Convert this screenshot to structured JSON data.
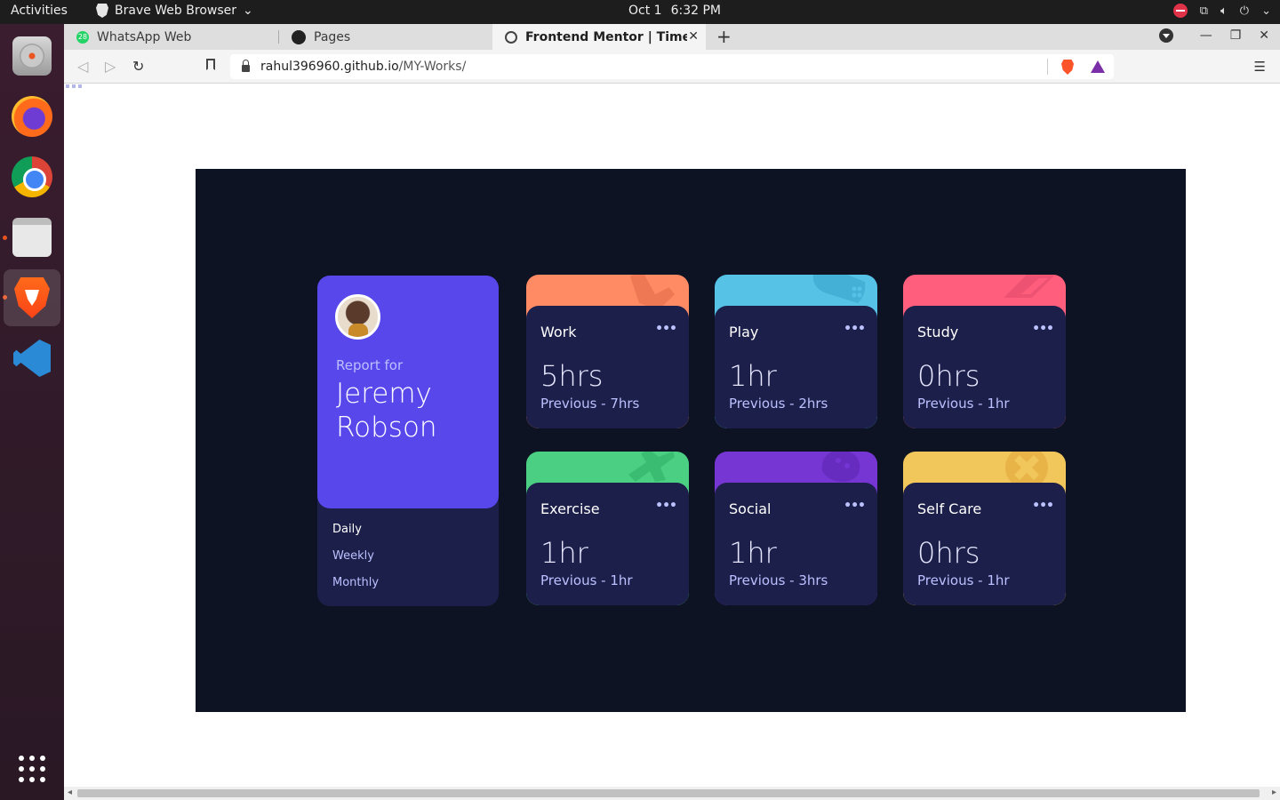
{
  "system": {
    "activities": "Activities",
    "app_name": "Brave Web Browser",
    "date": "Oct 1",
    "time": "6:32 PM"
  },
  "dock": {
    "items": [
      "disk-utility",
      "firefox",
      "chrome",
      "files",
      "brave",
      "vscode",
      "show-apps"
    ],
    "active": "brave"
  },
  "browser": {
    "tabs": [
      {
        "label": "WhatsApp Web",
        "badge": "28"
      },
      {
        "label": "Pages"
      },
      {
        "label": "Frontend Mentor | Time tr",
        "active": true
      }
    ],
    "url": {
      "host": "rahul396960.github.io",
      "path": "/MY-Works/"
    }
  },
  "dashboard": {
    "profile": {
      "report_for": "Report for",
      "name": "Jeremy Robson"
    },
    "periods": [
      "Daily",
      "Weekly",
      "Monthly"
    ],
    "selected_period": "Daily",
    "more_glyph": "•••",
    "cards": [
      {
        "title": "Work",
        "hours": "5hrs",
        "previous": "Previous - 7hrs",
        "color": "#ff8b64"
      },
      {
        "title": "Play",
        "hours": "1hr",
        "previous": "Previous - 2hrs",
        "color": "#56c2e6"
      },
      {
        "title": "Study",
        "hours": "0hrs",
        "previous": "Previous - 1hr",
        "color": "#ff5e7d"
      },
      {
        "title": "Exercise",
        "hours": "1hr",
        "previous": "Previous - 1hr",
        "color": "#4bcf83"
      },
      {
        "title": "Social",
        "hours": "1hr",
        "previous": "Previous - 3hrs",
        "color": "#7536d3"
      },
      {
        "title": "Self Care",
        "hours": "0hrs",
        "previous": "Previous - 1hr",
        "color": "#f1c65b"
      }
    ]
  },
  "colors": {
    "stage_bg": "#0e1323",
    "card_bg": "#1c1f4a",
    "profile_bg": "#5847eb",
    "muted_text": "#bbc0ff"
  }
}
